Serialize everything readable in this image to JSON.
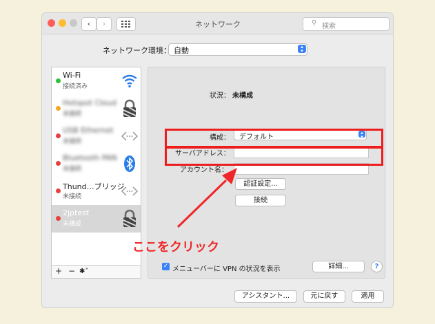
{
  "window": {
    "title": "ネットワーク",
    "search_placeholder": "検索"
  },
  "nav": {
    "back": "‹",
    "forward": "›"
  },
  "location": {
    "label": "ネットワーク環境：",
    "value": "自動"
  },
  "services": [
    {
      "name": "Wi-Fi",
      "status": "接続済み",
      "dot": "#2fbf3a",
      "icon": "wifi-icon",
      "blurred": false,
      "selected": false
    },
    {
      "name": "Hotspot Cloud",
      "status": "未接続",
      "dot": "#f5a623",
      "icon": "lock-icon",
      "blurred": true,
      "selected": false
    },
    {
      "name": "USB Ethernet",
      "status": "未接続",
      "dot": "#e84040",
      "icon": "ethernet-icon",
      "blurred": true,
      "selected": false
    },
    {
      "name": "Bluetooth PAN",
      "status": "未接続",
      "dot": "#e84040",
      "icon": "bluetooth-icon",
      "blurred": true,
      "selected": false
    },
    {
      "name": "Thund…ブリッジ",
      "status": "未接続",
      "dot": "#e84040",
      "icon": "ethernet-icon",
      "blurred": false,
      "selected": false
    },
    {
      "name": "2jptest",
      "status": "未構成",
      "dot": "#e84040",
      "icon": "lock-icon",
      "blurred": false,
      "selected": true
    }
  ],
  "sidebar_footer": {
    "add": "+",
    "remove": "−",
    "gear": "✱˅"
  },
  "detail": {
    "status_label": "状況：",
    "status_value": "未構成",
    "config_label": "構成：",
    "config_value": "デフォルト",
    "server_label": "サーバアドレス：",
    "server_value": "",
    "account_label": "アカウント名：",
    "account_value": "",
    "auth_button": "認証設定...",
    "connect_button": "接続",
    "menu_vpn_label": "メニューバーに VPN の状況を表示",
    "menu_vpn_checked": "✓",
    "advanced_button": "詳細...",
    "help_button": "?"
  },
  "footer": {
    "assist": "アシスタント...",
    "revert": "元に戻す",
    "apply": "適用"
  },
  "annotation": {
    "text": "ここをクリック",
    "color": "#f0272a"
  },
  "colors": {
    "accent": "#3b82f6",
    "highlight": "#ee1c1c"
  }
}
